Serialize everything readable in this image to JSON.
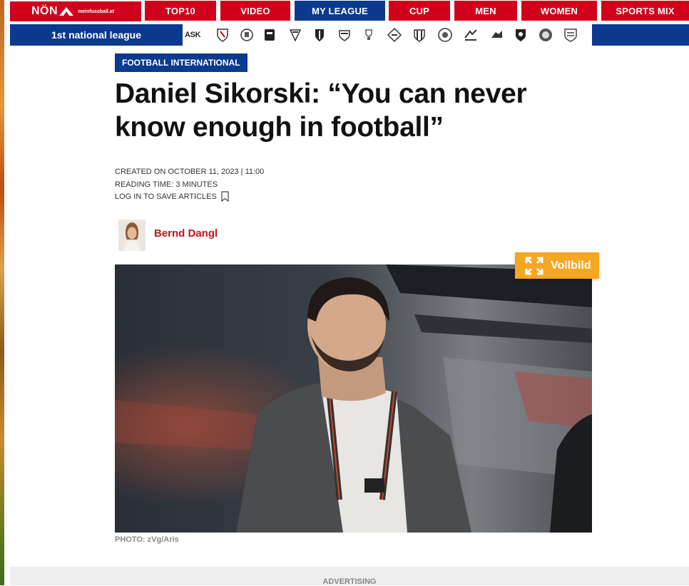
{
  "nav": {
    "logo_text": "NÖN",
    "logo_sub": "meinfussball.at",
    "items": [
      "TOP10",
      "VIDEO",
      "MY LEAGUE",
      "CUP",
      "MEN",
      "WOMEN",
      "SPORTS MIX"
    ]
  },
  "league_bar": {
    "label": "1st national league",
    "first_club_text": "ASK"
  },
  "article": {
    "category": "FOOTBALL INTERNATIONAL",
    "headline": "Daniel Sikorski: “You can never know enough in football”",
    "created": "CREATED ON OCTOBER 11, 2023 | 11:00",
    "reading_time": "READING TIME: 3 MINUTES",
    "save_label": "LOG IN TO SAVE ARTICLES",
    "author": "Bernd Dangl",
    "fullscreen_label": "Vollbild",
    "photo_credit": "PHOTO: zVg/Aris"
  },
  "ad": {
    "label": "ADVERTISING"
  },
  "colors": {
    "red": "#d0021b",
    "blue": "#0b3a8f",
    "orange": "#f5a623"
  }
}
